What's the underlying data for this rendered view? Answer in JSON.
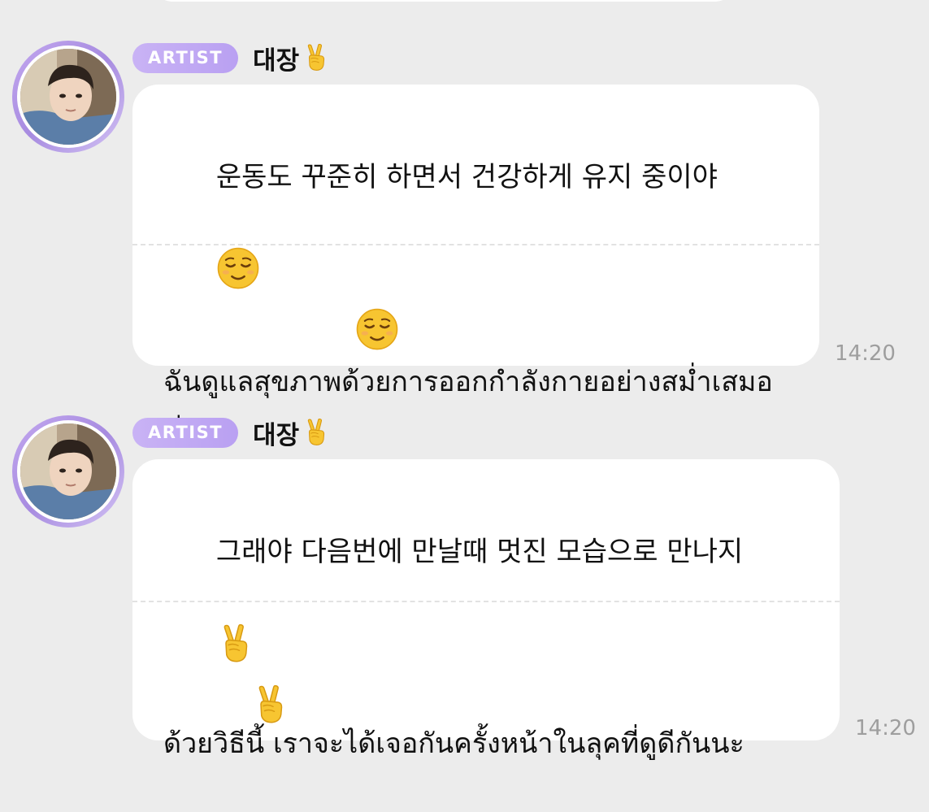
{
  "messages": [
    {
      "badge": "ARTIST",
      "sender": "대장",
      "sender_emoji": "victory-hand-icon",
      "original_text": "운동도 꾸준히 하면서 건강하게 유지 중이야",
      "original_emoji": "relieved-face-icon",
      "translated_text": "ฉันดูแลสุขภาพด้วยการออกกำลังกายอย่างสม่ำเสมอค่ะ",
      "translated_emoji": "relieved-face-icon",
      "time": "14:20"
    },
    {
      "badge": "ARTIST",
      "sender": "대장",
      "sender_emoji": "victory-hand-icon",
      "original_text": "그래야 다음번에 만날때 멋진 모습으로 만나지",
      "original_emoji": "victory-hand-icon",
      "translated_text": "ด้วยวิธีนี้ เราจะได้เจอกันครั้งหน้าในลุคที่ดูดีกันนะ",
      "translated_emoji": "victory-hand-icon",
      "time": "14:20"
    }
  ]
}
